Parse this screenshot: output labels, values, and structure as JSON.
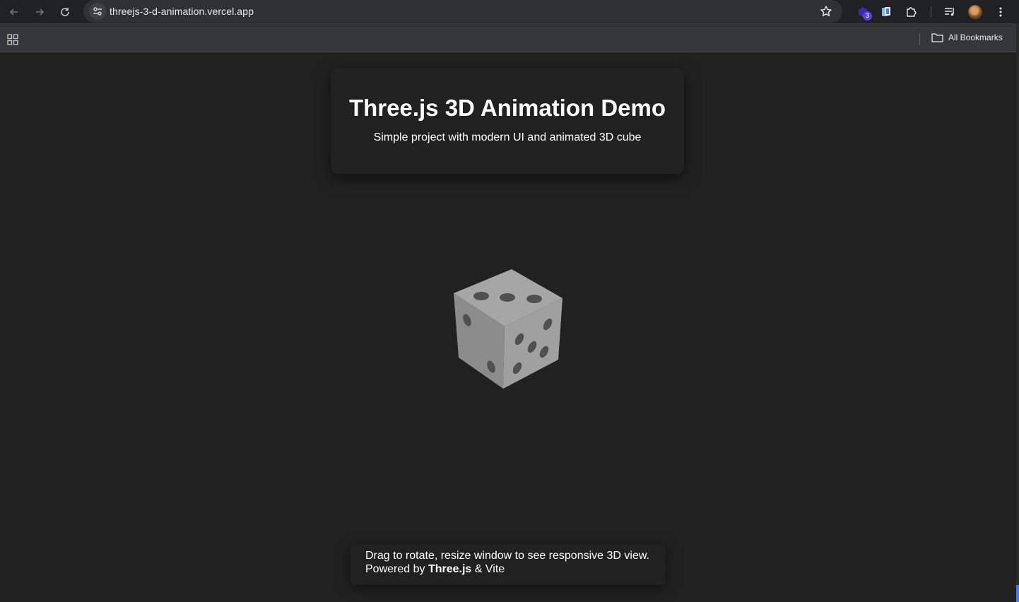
{
  "browser": {
    "url": "threejs-3-d-animation.vercel.app",
    "extension_badge_count": "3",
    "bookmarks_label": "All Bookmarks"
  },
  "page": {
    "title": "Three.js 3D Animation Demo",
    "subtitle": "Simple project with modern UI and animated 3D cube",
    "footer_line1": "Drag to rotate, resize window to see responsive 3D view.",
    "footer_prefix": "Powered by",
    "footer_brand": "Three.js",
    "footer_suffix": "& Vite"
  },
  "colors": {
    "background": "#212121",
    "toolbar": "#202124",
    "badge": "#5b3fd6"
  }
}
